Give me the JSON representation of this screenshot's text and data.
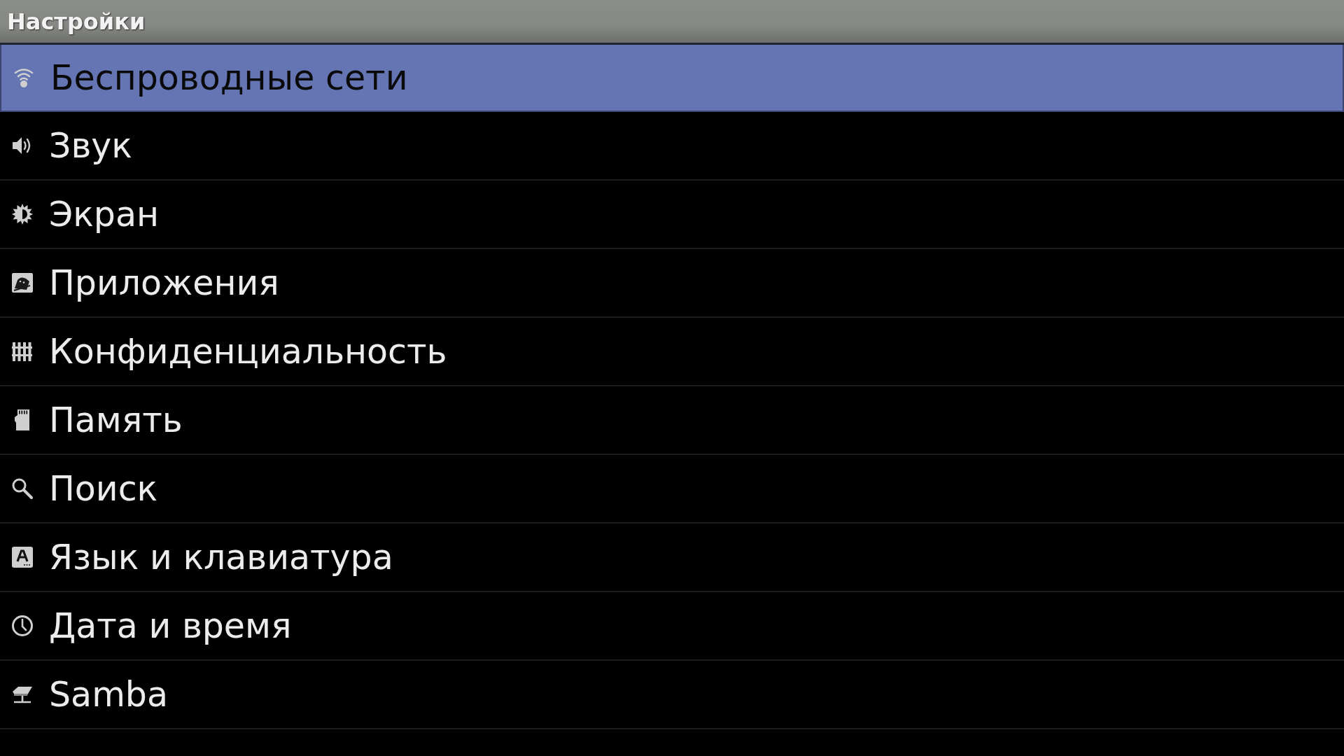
{
  "title": "Настройки",
  "items": [
    {
      "label": "Беспроводные сети",
      "selected": true
    },
    {
      "label": "Звук",
      "selected": false
    },
    {
      "label": "Экран",
      "selected": false
    },
    {
      "label": "Приложения",
      "selected": false
    },
    {
      "label": "Конфиденциальность",
      "selected": false
    },
    {
      "label": "Память",
      "selected": false
    },
    {
      "label": "Поиск",
      "selected": false
    },
    {
      "label": "Язык и клавиатура",
      "selected": false
    },
    {
      "label": "Дата и время",
      "selected": false
    },
    {
      "label": "Samba",
      "selected": false
    }
  ]
}
